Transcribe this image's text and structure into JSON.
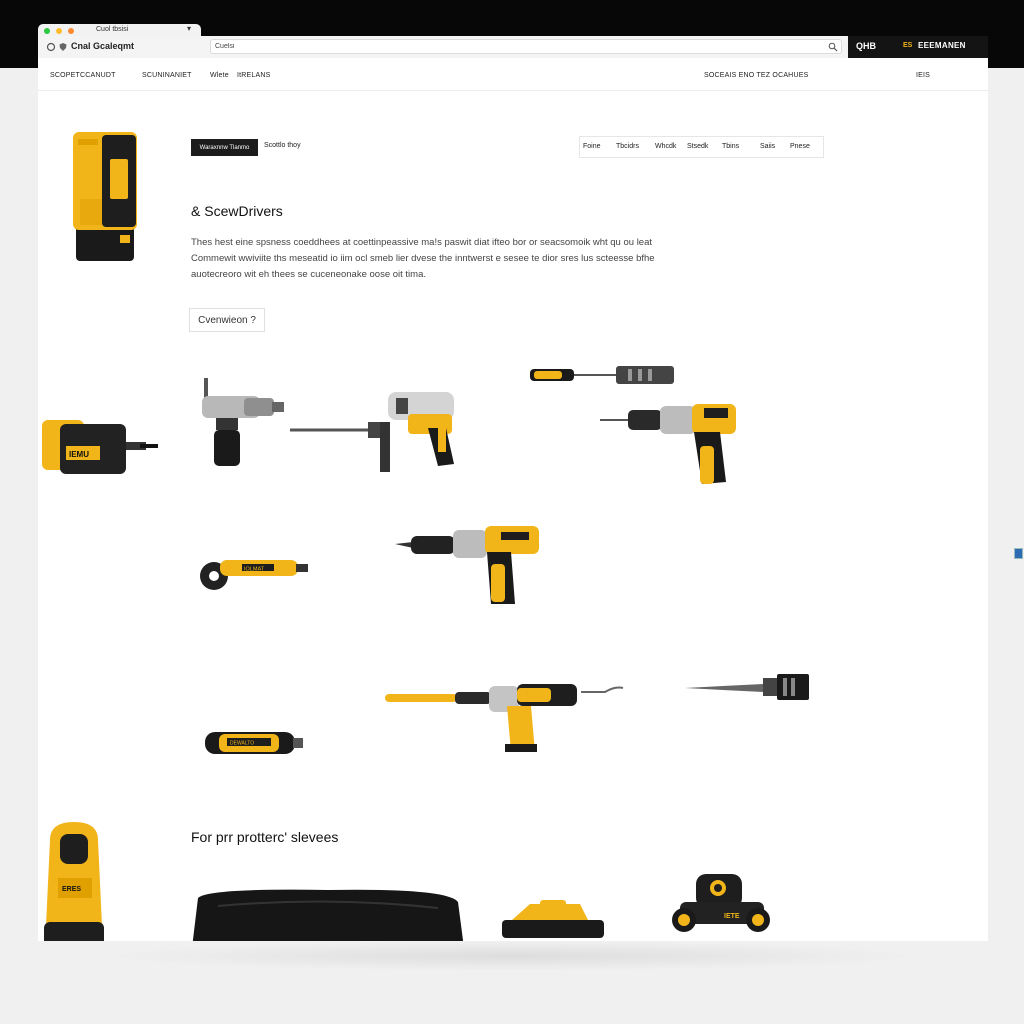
{
  "browser": {
    "tab_title": "Cuol tbsisi",
    "tab_close": "▾",
    "site_label": "Cnal Gcaleqmt",
    "url": "Cuelsi",
    "search_icon": "search-icon",
    "account_short": "QHB",
    "account_label": "EEEMANEN",
    "account_prefix": "ES"
  },
  "nav": {
    "links": [
      "SCOPETCCANUDT",
      "SCUNINANIET",
      "Wlete",
      "ItRELANS"
    ],
    "right_link": "SOCEAIS ENO TEZ OCAHUES",
    "cart": "IEIS"
  },
  "hero": {
    "cta_primary": "Waraxnnw Tlanmo",
    "cta_secondary": "Scottlo thoy",
    "filters": [
      "Foine",
      "Tbcidrs",
      "Whcdk",
      "Stsedk",
      "Tbins",
      "Saiis",
      "Pnese"
    ],
    "heading": "& ScewDrivers",
    "description": "Thes hest eine spsness coeddhees at coettinpeassive ma!s paswit diat ifteo bor or seacsomoik wht qu ou leat Commewit wwiviite ths meseatid io iim ocl smeb lier dvese the inntwerst e sesee te dior sres lus scteesse bfhe auotecreoro wit eh thees se cuceneonake oose oit tima.",
    "overview_button": "Cvenwieon ?"
  },
  "section2": {
    "heading": "For prr protterc' slevees"
  },
  "products": [
    {
      "name": "charger-battery",
      "icon": "battery-icon"
    },
    {
      "name": "hammer-drill",
      "icon": "drill-icon"
    },
    {
      "name": "rotary-hammer",
      "icon": "hammer-drill-icon"
    },
    {
      "name": "screwdriver",
      "icon": "screwdriver-icon"
    },
    {
      "name": "cordless-drill",
      "icon": "drill-icon"
    },
    {
      "name": "battery-pack",
      "icon": "battery-icon"
    },
    {
      "name": "angle-grinder",
      "icon": "grinder-icon"
    },
    {
      "name": "impact-driver",
      "icon": "drill-icon"
    },
    {
      "name": "long-drill",
      "icon": "drill-icon"
    },
    {
      "name": "drill-bit",
      "icon": "bit-icon"
    },
    {
      "name": "chisel",
      "icon": "chisel-icon"
    },
    {
      "name": "multi-tool",
      "icon": "multitool-icon"
    },
    {
      "name": "laser-level",
      "icon": "level-icon"
    },
    {
      "name": "tool-bag",
      "icon": "bag-icon"
    },
    {
      "name": "sander",
      "icon": "sander-icon"
    },
    {
      "name": "mini-vehicle",
      "icon": "vehicle-icon"
    }
  ],
  "product_labels": {
    "charger": "IEMU",
    "battery": "DEWALT",
    "drill": "DEWALT",
    "grinder": "IOLMAT",
    "multi": "DEWALTO",
    "level": "ERES",
    "vehicle": "IETE"
  },
  "colors": {
    "accent": "#f2b519",
    "dark": "#141414",
    "metal": "#a9a9a9",
    "background": "#ffffff"
  }
}
